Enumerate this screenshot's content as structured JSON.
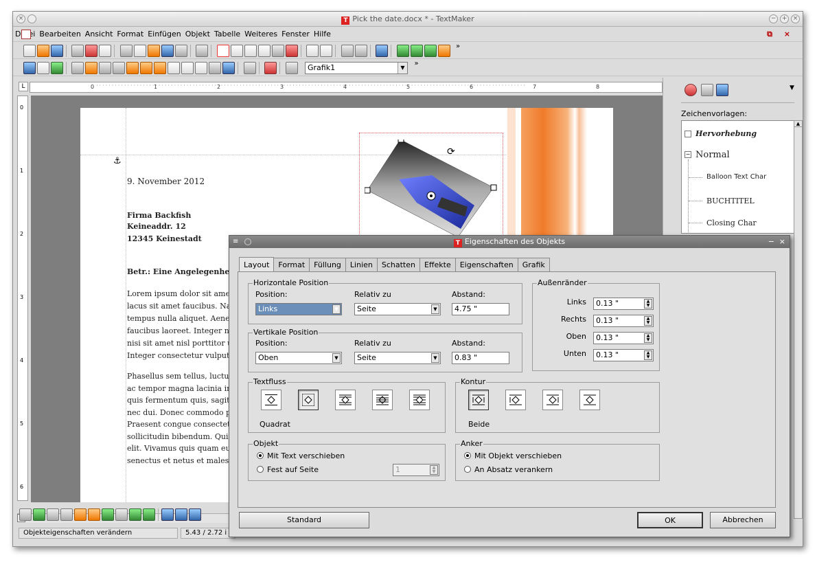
{
  "window": {
    "title": "Pick the date.docx * - TextMaker"
  },
  "menu": [
    "Datei",
    "Bearbeiten",
    "Ansicht",
    "Format",
    "Einfügen",
    "Objekt",
    "Tabelle",
    "Weiteres",
    "Fenster",
    "Hilfe"
  ],
  "toolbar2": {
    "object_combo": "Grafik1"
  },
  "ruler": {
    "marks": [
      "0",
      "1",
      "2",
      "3",
      "4",
      "5",
      "6",
      "7",
      "8"
    ]
  },
  "vruler": {
    "marks": [
      "0",
      "1",
      "2",
      "3",
      "4",
      "5",
      "6"
    ]
  },
  "document": {
    "date": "9. November 2012",
    "address": [
      "Firma Backfish",
      "Keineaddr. 12",
      "12345 Keinestadt"
    ],
    "subject": "Betr.: Eine Angelegenheit",
    "para1": [
      "Lorem ipsum dolor sit amet,",
      "lacus sit amet faucibus. Nam",
      "tempus nulla aliquet. Aenean",
      "faucibus laoreet. Integer nisi",
      "nisi sit amet nisl porttitor ut",
      "Integer consectetur vulputate"
    ],
    "para2": [
      "Phasellus sem tellus, luctus e",
      "ac tempor magna lacinia in. N",
      "quis fermentum quis, sagittis",
      "nec dui. Donec commodo pre",
      "Praesent congue consectetur",
      "sollicitudin bibendum. Quisq",
      "elit. Vivamus quis quam eu q",
      "senectus et netus et malesuad"
    ]
  },
  "sidepanel": {
    "heading": "Zeichenvorlagen:",
    "items": [
      "Hervorhebung",
      "Normal",
      "Balloon Text Char",
      "BUCHTITEL",
      "Closing Char"
    ]
  },
  "statusbar": {
    "message": "Objekteigenschaften verändern",
    "position": "5.43 / 2.72 i"
  },
  "dialog": {
    "title": "Eigenschaften des Objekts",
    "tabs": [
      "Layout",
      "Format",
      "Füllung",
      "Linien",
      "Schatten",
      "Effekte",
      "Eigenschaften",
      "Grafik"
    ],
    "horizontal": {
      "label": "Horizontale Position",
      "position_label": "Position:",
      "position_value": "Links",
      "relativ_label": "Relativ zu",
      "relativ_value": "Seite",
      "abstand_label": "Abstand:",
      "abstand_value": "4.75 \""
    },
    "vertical": {
      "label": "Vertikale Position",
      "position_label": "Position:",
      "position_value": "Oben",
      "relativ_label": "Relativ zu",
      "relativ_value": "Seite",
      "abstand_label": "Abstand:",
      "abstand_value": "0.83 \""
    },
    "margins": {
      "label": "Außenränder",
      "links_label": "Links",
      "links_value": "0.13 \"",
      "rechts_label": "Rechts",
      "rechts_value": "0.13 \"",
      "oben_label": "Oben",
      "oben_value": "0.13 \"",
      "unten_label": "Unten",
      "unten_value": "0.13 \""
    },
    "textfluss": {
      "label": "Textfluss",
      "selected_caption": "Quadrat"
    },
    "kontur": {
      "label": "Kontur",
      "selected_caption": "Beide"
    },
    "objekt": {
      "label": "Objekt",
      "opt1": "Mit Text verschieben",
      "opt2": "Fest auf Seite",
      "page_value": "1"
    },
    "anker": {
      "label": "Anker",
      "opt1": "Mit Objekt verschieben",
      "opt2": "An Absatz verankern"
    },
    "buttons": {
      "standard": "Standard",
      "ok": "OK",
      "cancel": "Abbrechen"
    }
  }
}
